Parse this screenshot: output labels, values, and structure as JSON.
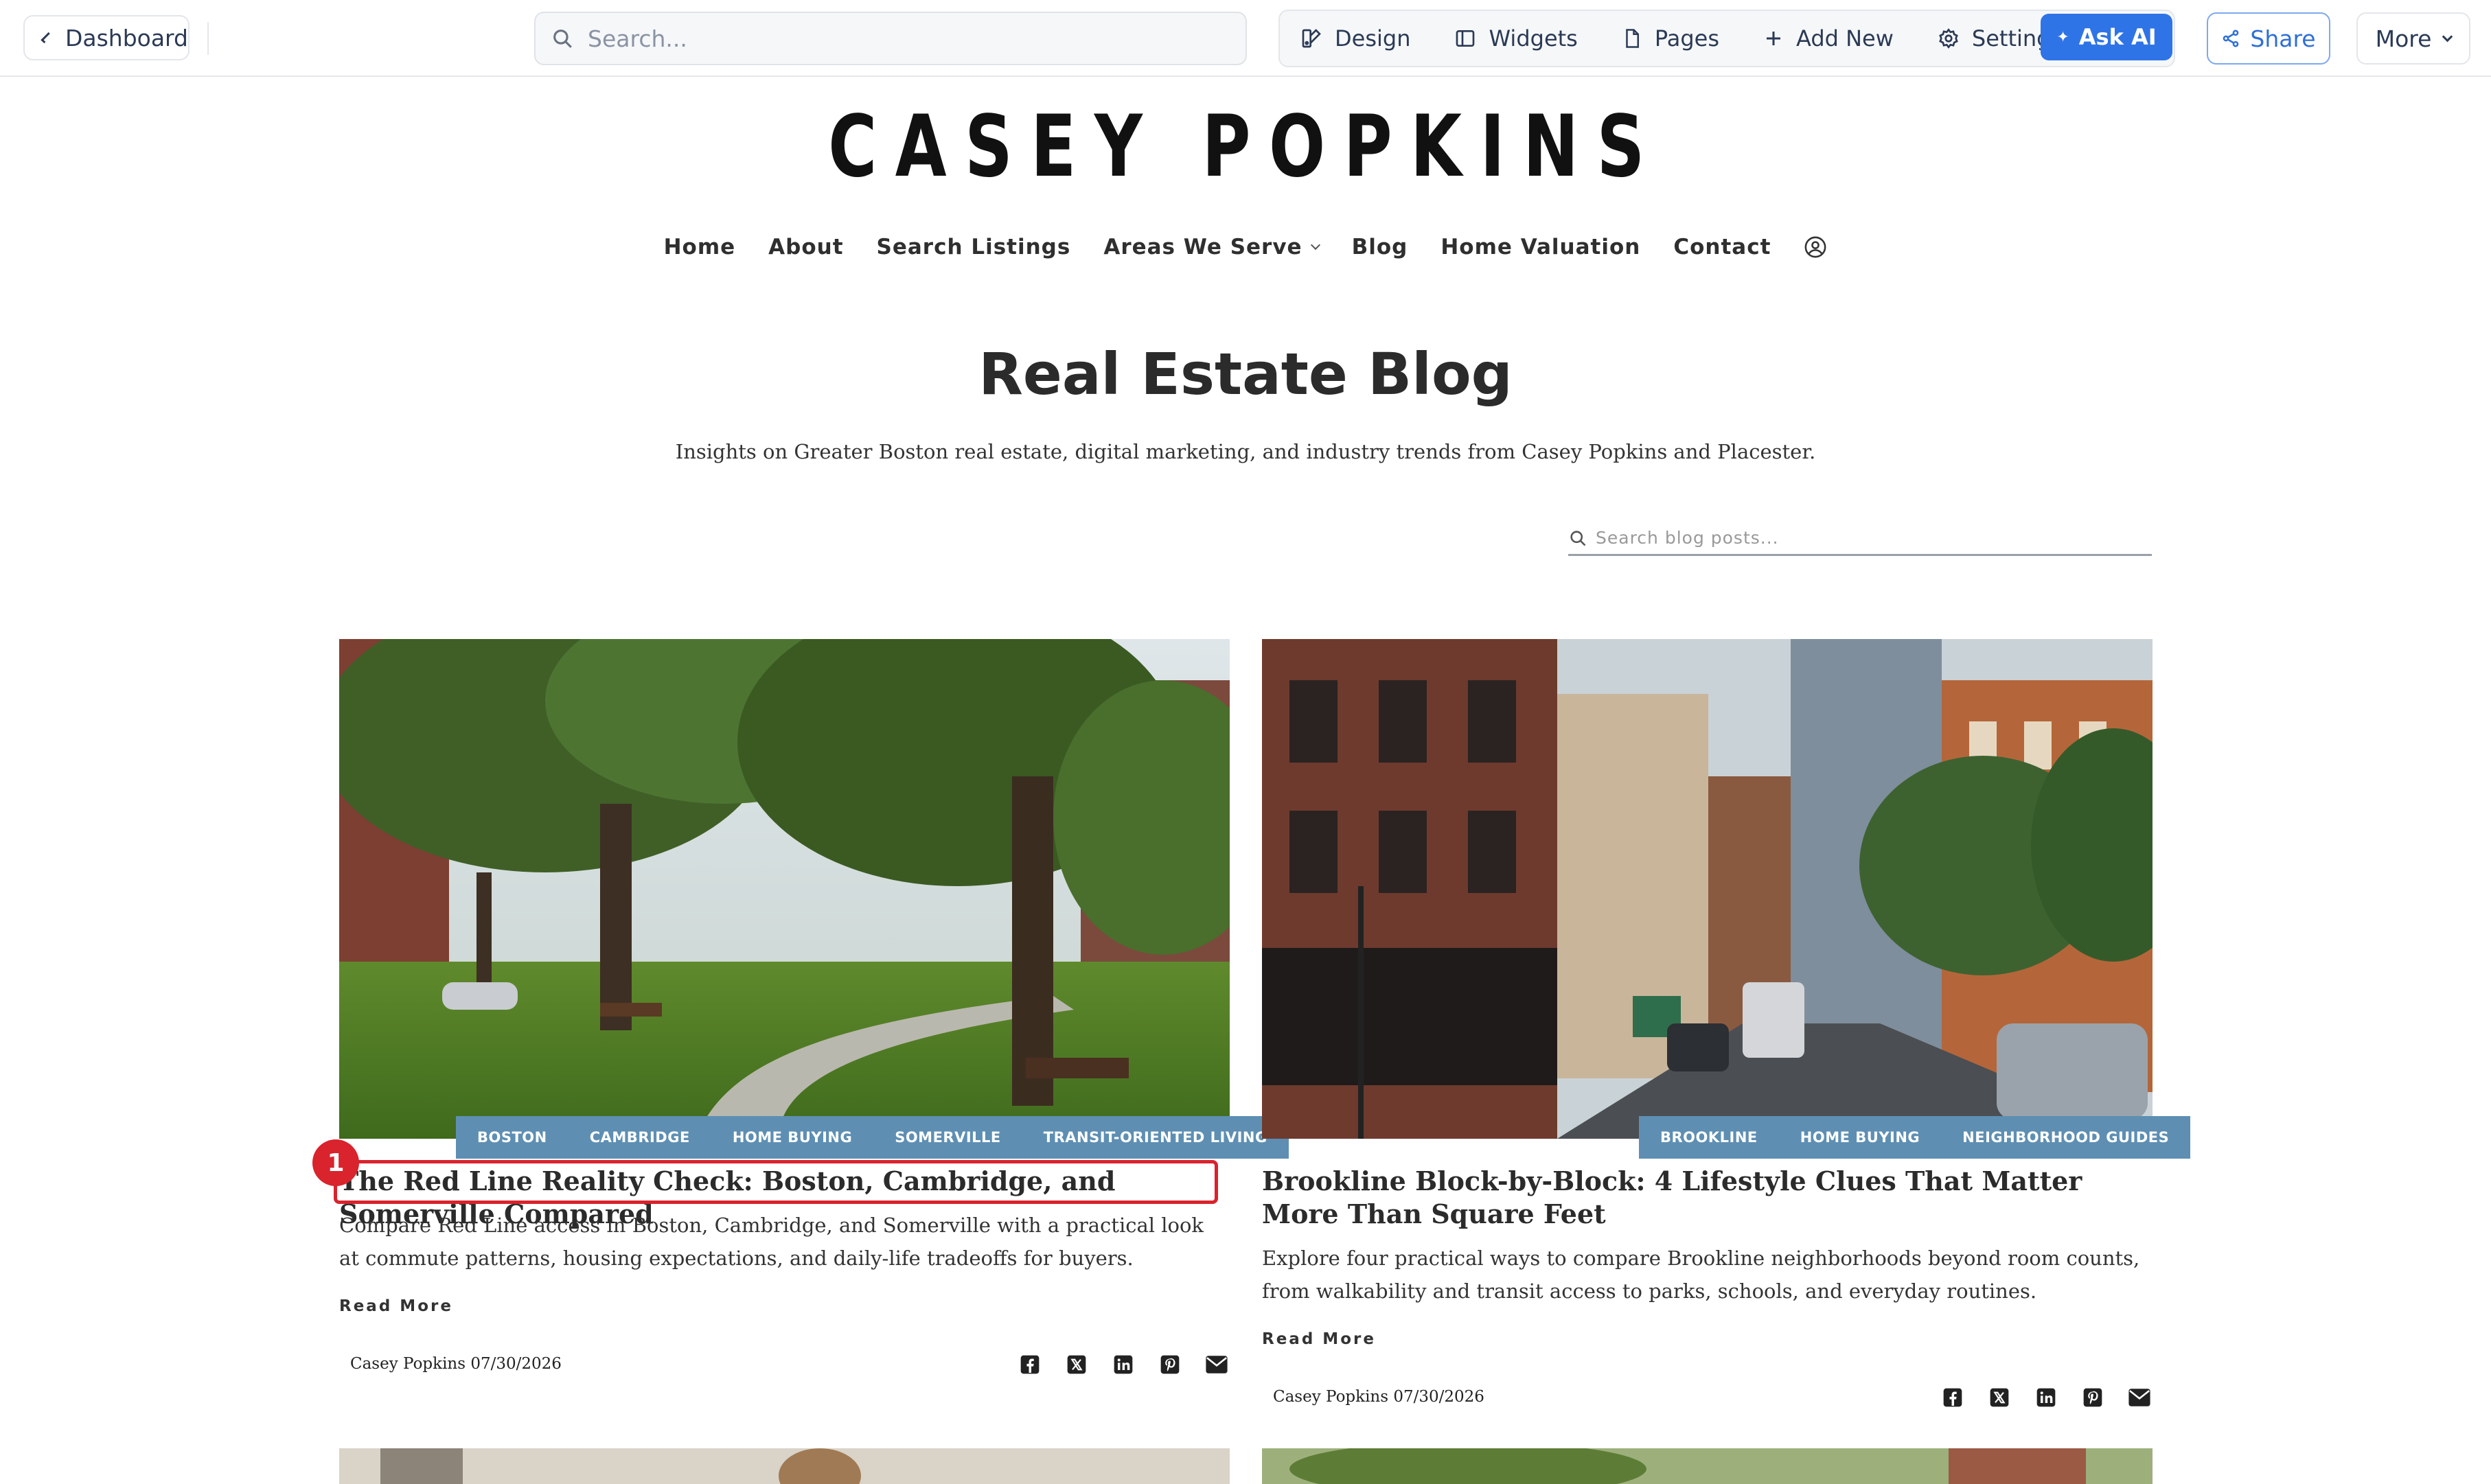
{
  "toolbar": {
    "dashboard_label": "Dashboard",
    "search_placeholder": "Search...",
    "tools": {
      "design": "Design",
      "widgets": "Widgets",
      "pages": "Pages",
      "add_new": "Add New",
      "settings": "Settings",
      "ask_ai": "Ask AI"
    },
    "share_label": "Share",
    "more_label": "More",
    "accent_color": "#2f74e6"
  },
  "site": {
    "logo": "CASEY POPKINS",
    "nav": {
      "home": "Home",
      "about": "About",
      "search_listings": "Search Listings",
      "areas": "Areas We Serve",
      "blog": "Blog",
      "home_valuation": "Home Valuation",
      "contact": "Contact"
    }
  },
  "blog": {
    "title": "Real Estate Blog",
    "subtitle": "Insights on Greater Boston real estate, digital marketing, and industry trends from Casey Popkins and Placester.",
    "search_placeholder": "Search blog posts..."
  },
  "posts": [
    {
      "tags": [
        "BOSTON",
        "CAMBRIDGE",
        "HOME BUYING",
        "SOMERVILLE",
        "TRANSIT-ORIENTED LIVING"
      ],
      "title": "The Red Line Reality Check: Boston, Cambridge, and Somerville Compared",
      "excerpt": "Compare Red Line access in Boston, Cambridge, and Somerville with a practical look at commute patterns, housing expectations, and daily-life tradeoffs for buyers.",
      "read_more": "Read More",
      "byline": "Casey Popkins 07/30/2026"
    },
    {
      "tags": [
        "BROOKLINE",
        "HOME BUYING",
        "NEIGHBORHOOD GUIDES"
      ],
      "title": "Brookline Block-by-Block: 4 Lifestyle Clues That Matter More Than Square Feet",
      "excerpt": "Explore four practical ways to compare Brookline neighborhoods beyond room counts, from walkability and transit access to parks, schools, and everyday routines.",
      "read_more": "Read More",
      "byline": "Casey Popkins 07/30/2026"
    }
  ],
  "annotation": {
    "marker_number": "1",
    "color": "#d9232d"
  },
  "tag_color": "#5e8fb3"
}
